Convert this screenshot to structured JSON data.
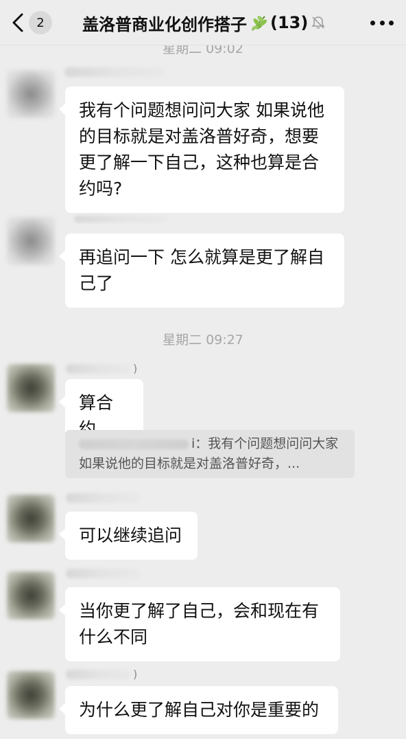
{
  "header": {
    "back_label": "<",
    "unread_count": "2",
    "title": "盖洛普商业化创作搭子",
    "member_count": "(13)",
    "icons": {
      "back": "chevron-left-icon",
      "group": "leaf-icon",
      "mute": "bell-muted-icon",
      "more": "more-dots-icon"
    }
  },
  "timestamps": {
    "top_partial": "星期二 09:02",
    "second": "星期二 09:27"
  },
  "messages": [
    {
      "sender": "blurred",
      "text": "我有个问题想问问大家 如果说他的目标就是对盖洛普好奇，想要更了解一下自己，这种也算是合约吗?"
    },
    {
      "sender": "blurred",
      "text": "再追问一下 怎么就算是更了解自己了"
    },
    {
      "sender": "blurred",
      "sender_suffix": ")",
      "text": "算合约",
      "quote": {
        "sender_suffix": "i：",
        "text": "我有个问题想问问大家 如果说他的目标就是对盖洛普好奇，..."
      }
    },
    {
      "sender": "blurred",
      "text": "可以继续追问"
    },
    {
      "sender": "blurred",
      "text": "当你更了解了自己，会和现在有什么不同"
    },
    {
      "sender": "blurred",
      "sender_suffix": ")",
      "text": "为什么更了解自己对你是重要的"
    }
  ],
  "colors": {
    "background": "#ededed",
    "bubble": "#ffffff",
    "quote_bg": "#e2e2e2",
    "timestamp": "#a6a6a6",
    "leaf": "#7cb342"
  }
}
